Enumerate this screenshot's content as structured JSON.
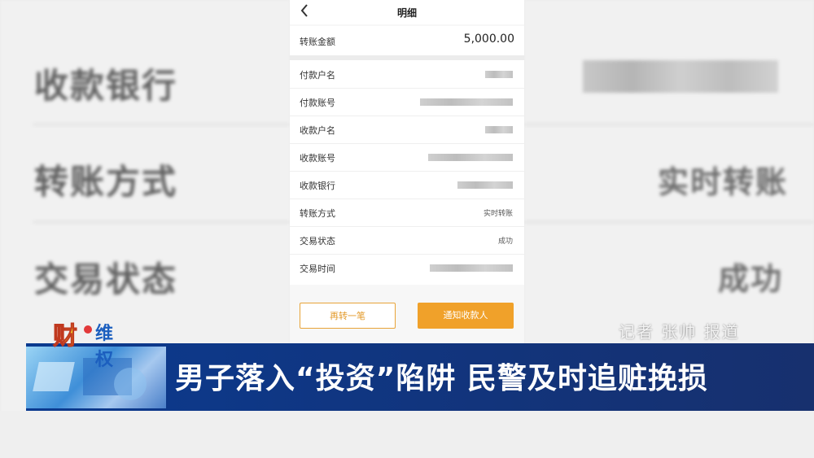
{
  "background": {
    "labels": [
      "收款银行",
      "转账方式",
      "交易状态"
    ],
    "values": {
      "transfer_method": "实时转账",
      "status": "成功"
    }
  },
  "app": {
    "nav": {
      "back_icon": "chevron-left-icon",
      "title": "明细"
    },
    "amount": {
      "label": "转账金额",
      "value": "5,000.00"
    },
    "rows": [
      {
        "label": "付款户名"
      },
      {
        "label": "付款账号"
      },
      {
        "label": "收款户名"
      },
      {
        "label": "收款账号"
      },
      {
        "label": "收款银行"
      },
      {
        "label": "转账方式",
        "value": "实时转账"
      },
      {
        "label": "交易状态",
        "value": "成功"
      },
      {
        "label": "交易时间"
      }
    ],
    "buttons": {
      "again": "再转一笔",
      "notify": "通知收款人"
    },
    "colors": {
      "accent": "#f0a12a"
    }
  },
  "overlay": {
    "logo_cai": "财",
    "logo_weiquan": "维权",
    "reporter": "记者 张帅 报道",
    "headline": "男子落入“投资”陷阱 民警及时追赃挽损"
  }
}
